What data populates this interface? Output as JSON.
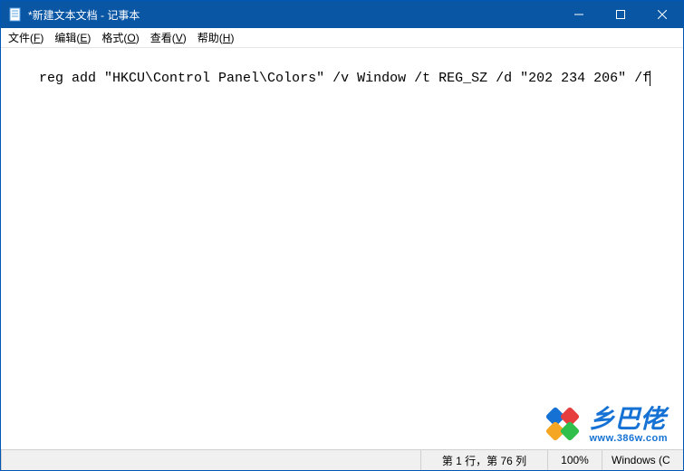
{
  "titlebar": {
    "icon": "notepad-icon",
    "title": "*新建文本文档 - 记事本"
  },
  "window_controls": {
    "minimize": "−",
    "maximize": "□",
    "close": "×"
  },
  "menubar": {
    "items": [
      {
        "label": "文件",
        "accel": "F"
      },
      {
        "label": "编辑",
        "accel": "E"
      },
      {
        "label": "格式",
        "accel": "O"
      },
      {
        "label": "查看",
        "accel": "V"
      },
      {
        "label": "帮助",
        "accel": "H"
      }
    ]
  },
  "editor": {
    "content": "reg add \"HKCU\\Control Panel\\Colors\" /v Window /t REG_SZ /d \"202 234 206\" /f"
  },
  "statusbar": {
    "position": "第 1 行，第 76 列",
    "zoom": "100%",
    "encoding": "Windows (C"
  },
  "watermark": {
    "name": "乡巴佬",
    "url": "www.386w.com"
  }
}
